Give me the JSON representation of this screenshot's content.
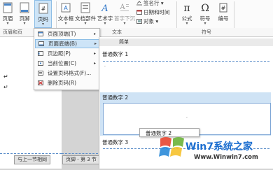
{
  "ribbon": {
    "buttons": [
      {
        "label": "页眉",
        "dropdown": "▾",
        "icon": "header-icon"
      },
      {
        "label": "页脚",
        "dropdown": "▾",
        "icon": "footer-icon"
      },
      {
        "label": "页码",
        "dropdown": "▾",
        "icon": "page-number-icon"
      },
      {
        "label": "文本框",
        "dropdown": "▾",
        "icon": "textbox-icon"
      },
      {
        "label": "文档部件",
        "dropdown": "▾",
        "icon": "quick-parts-icon"
      },
      {
        "label": "艺术字",
        "dropdown": "▾",
        "icon": "wordart-icon"
      },
      {
        "label": "首字下沉",
        "dropdown": "▾",
        "icon": "drop-cap-icon"
      },
      {
        "label": "公式",
        "dropdown": "▾",
        "icon": "equation-icon"
      },
      {
        "label": "符号",
        "dropdown": "▾",
        "icon": "symbol-icon"
      },
      {
        "label": "编号",
        "dropdown": "",
        "icon": "numbering-icon"
      }
    ],
    "small_buttons": [
      {
        "label": "签名行 ▾",
        "icon": "signature-icon"
      },
      {
        "label": "日期和时间",
        "icon": "calendar-icon"
      },
      {
        "label": "对象 ▾",
        "icon": "object-icon"
      }
    ],
    "groups": {
      "header_footer": "页眉和页",
      "text": "文本",
      "symbols": "符号"
    },
    "symbol_glyphs": {
      "pi": "π",
      "omega": "Ω",
      "hash": "#"
    }
  },
  "menu": {
    "items": [
      {
        "label": "页面顶端(T)",
        "icon": "page-top-icon",
        "arrow": "▸",
        "highlighted": false
      },
      {
        "label": "页面底端(B)",
        "icon": "page-bottom-icon",
        "arrow": "▸",
        "highlighted": true
      },
      {
        "label": "页边距(P)",
        "icon": "margin-icon",
        "arrow": "▸",
        "highlighted": false
      },
      {
        "label": "当前位置(C)",
        "icon": "current-position-icon",
        "arrow": "▸",
        "highlighted": false
      },
      {
        "label": "设置页码格式(F)...",
        "icon": "format-page-number-icon",
        "arrow": "",
        "highlighted": false
      },
      {
        "label": "删除页码(R)",
        "icon": "remove-page-number-icon",
        "arrow": "",
        "highlighted": false
      }
    ]
  },
  "gallery": {
    "section_header": "简单",
    "items": [
      {
        "title": "普通数字 1",
        "selected": false
      },
      {
        "title": "普通数字 2",
        "selected": true
      },
      {
        "title": "普通数字 3",
        "selected": false
      }
    ],
    "tooltip": "普通数字 2"
  },
  "document": {
    "paragraph_mark": "↵",
    "tags": {
      "link_previous": "与上一节相同",
      "footer_section": "页脚 - 第 3 节"
    }
  },
  "watermark": {
    "brand": "Win7系统之家",
    "url": "Www.Winwin7.com"
  },
  "colors": {
    "highlight": "#cde4f7",
    "selected_item": "#cfe3f5",
    "accent_blue": "#2e75c8"
  }
}
